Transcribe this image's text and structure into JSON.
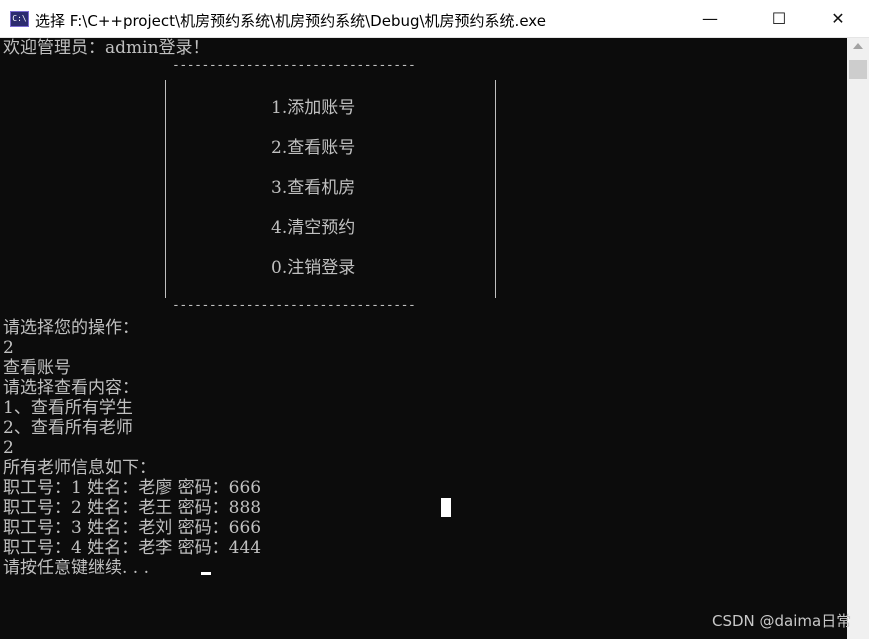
{
  "window": {
    "icon_text": "C:\\",
    "title": "选择 F:\\C++project\\机房预约系统\\机房预约系统\\Debug\\机房预约系统.exe",
    "min_glyph": "—",
    "max_glyph": "☐",
    "close_glyph": "✕"
  },
  "console": {
    "welcome": "欢迎管理员：admin登录！",
    "dash_line": "---------------------------------",
    "menu": [
      "1.添加账号",
      "2.查看账号",
      "3.查看机房",
      "4.清空预约",
      "0.注销登录"
    ],
    "output": [
      "请选择您的操作：",
      "2",
      "查看账号",
      "请选择查看内容：",
      "1、查看所有学生",
      "2、查看所有老师",
      "2",
      "所有老师信息如下：",
      "职工号：1 姓名：老廖 密码：666",
      "职工号：2 姓名：老王 密码：888",
      "职工号：3 姓名：老刘 密码：666",
      "职工号：4 姓名：老李 密码：444",
      "请按任意键继续. . ."
    ]
  },
  "watermark": "CSDN @daima日常"
}
